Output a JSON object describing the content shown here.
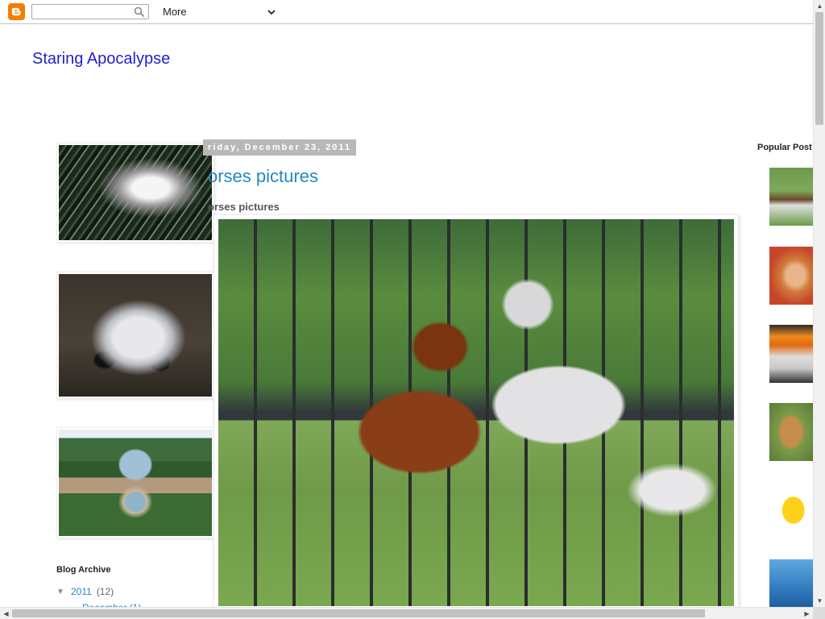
{
  "navbar": {
    "search_placeholder": "",
    "more_label": "More"
  },
  "blog": {
    "title": "Staring Apocalypse"
  },
  "post": {
    "date": "riday, December 23, 2011",
    "title": "orses pictures",
    "subtitle": "orses pictures"
  },
  "sidebar_left": {
    "archive_heading": "Blog Archive",
    "archive_year": "2011",
    "archive_year_count": "(12)",
    "archive_month_partial": "December (1)"
  },
  "sidebar_right": {
    "popular_heading": "Popular Post"
  },
  "colors": {
    "link": "#2288bb",
    "title": "#2222cc",
    "date_header_bg": "#b8b8b8",
    "blogger_orange": "#f57d00"
  }
}
